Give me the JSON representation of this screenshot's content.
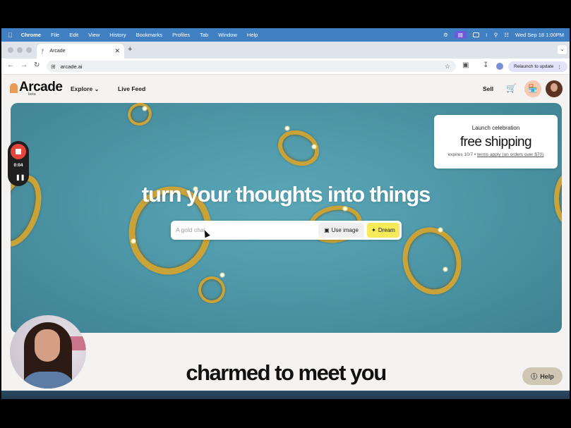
{
  "menubar": {
    "apple": "",
    "app": "Chrome",
    "menus": [
      "File",
      "Edit",
      "View",
      "History",
      "Bookmarks",
      "Profiles",
      "Tab",
      "Window",
      "Help"
    ],
    "datetime": "Wed Sep 18  1:00PM"
  },
  "browser": {
    "tab_title": "Arcade",
    "url": "arcade.ai",
    "relaunch_label": "Relaunch to update"
  },
  "site": {
    "logo": "Arcade",
    "beta": "beta",
    "nav": {
      "explore": "Explore",
      "live_feed": "Live Feed"
    },
    "sell": "Sell"
  },
  "hero": {
    "headline": "turn your thoughts into things",
    "search_text": "A gold chai",
    "use_image": "Use image",
    "dream": "Dream"
  },
  "promo": {
    "title": "Launch celebration",
    "headline": "free shipping",
    "expires": "expires 10/7 • ",
    "terms": "terms apply (on orders over $70)"
  },
  "section_title": "charmed to meet you",
  "help": "Help",
  "recorder": {
    "time": "0:04"
  },
  "colors": {
    "menubar": "#3f7fc2",
    "hero": "#4e98a9",
    "dream": "#f4ea5a",
    "record": "#e5453b",
    "help": "#cfc7b3"
  }
}
